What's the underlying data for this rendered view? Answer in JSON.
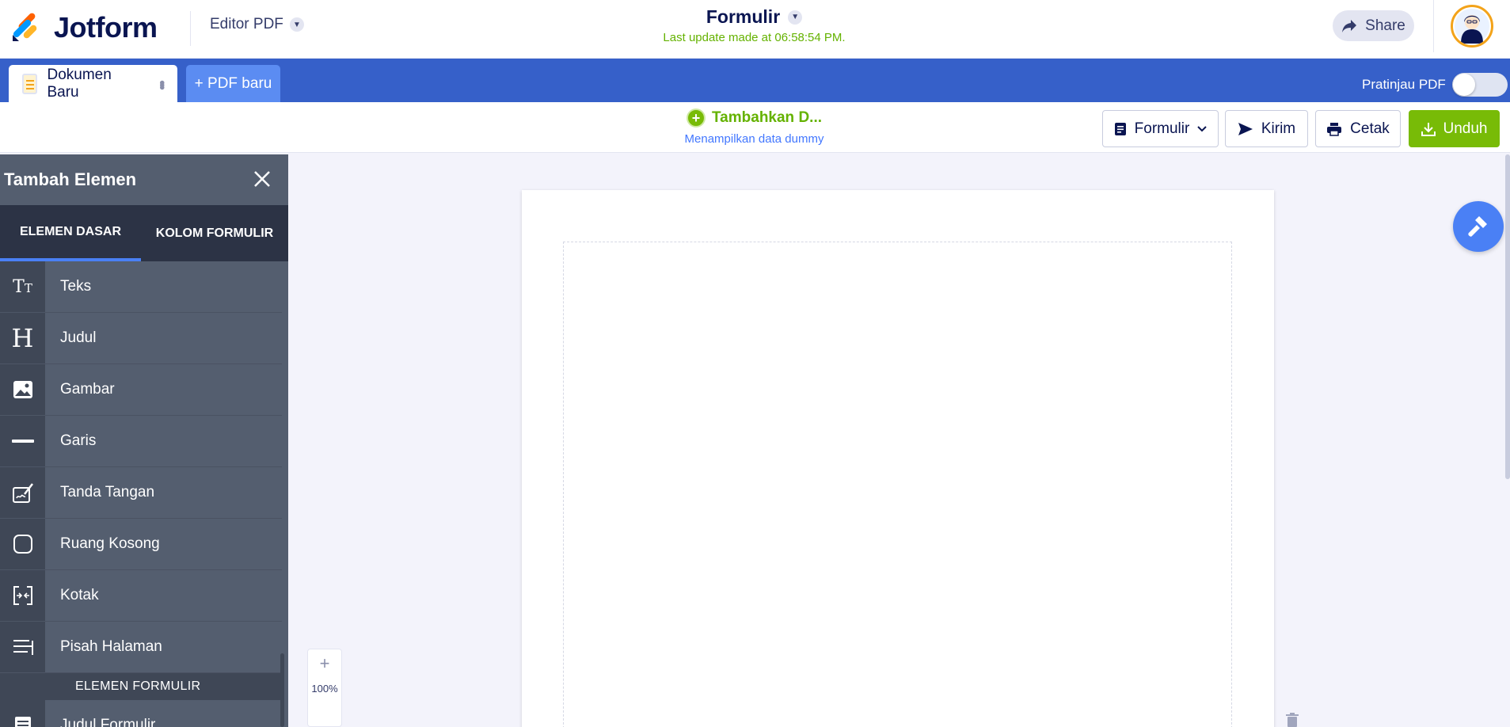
{
  "header": {
    "logo_text": "Jotform",
    "editor_label": "Editor PDF",
    "form_title": "Formulir",
    "last_update": "Last update made at 06:58:54 PM.",
    "share_label": "Share"
  },
  "tabs": {
    "document_tab": "Dokumen Baru",
    "new_pdf": "+ PDF baru",
    "preview_label": "Pratinjau PDF"
  },
  "actions": {
    "add_data": "Tambahkan D...",
    "dummy_note": "Menampilkan data dummy",
    "form_button": "Formulir",
    "send_button": "Kirim",
    "print_button": "Cetak",
    "download_button": "Unduh"
  },
  "sidebar": {
    "title": "Tambah Elemen",
    "tab_basic": "ELEMEN DASAR",
    "tab_form": "KOLOM FORMULIR",
    "items": [
      {
        "label": "Teks",
        "icon": "text-icon"
      },
      {
        "label": "Judul",
        "icon": "heading-icon"
      },
      {
        "label": "Gambar",
        "icon": "image-icon"
      },
      {
        "label": "Garis",
        "icon": "line-icon"
      },
      {
        "label": "Tanda Tangan",
        "icon": "signature-icon"
      },
      {
        "label": "Ruang Kosong",
        "icon": "spacer-icon"
      },
      {
        "label": "Kotak",
        "icon": "box-icon"
      },
      {
        "label": "Pisah Halaman",
        "icon": "page-break-icon"
      }
    ],
    "section_label": "ELEMEN FORMULIR",
    "form_items": [
      {
        "label": "Judul Formulir",
        "icon": "form-title-icon"
      }
    ]
  },
  "canvas": {
    "zoom_level": "100%"
  },
  "colors": {
    "brand_blue": "#3660c9",
    "accent_green": "#78bb07",
    "sidebar_bg": "#545e6f"
  }
}
